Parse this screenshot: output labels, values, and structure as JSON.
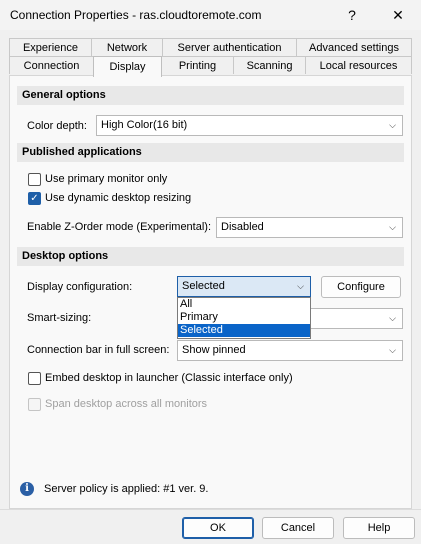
{
  "window": {
    "title": "Connection Properties - ras.cloudtoremote.com",
    "help_glyph": "?",
    "close_glyph": "✕"
  },
  "tabs": {
    "row1": [
      "Experience",
      "Network",
      "Server authentication",
      "Advanced settings"
    ],
    "row2": [
      "Connection",
      "Display",
      "Printing",
      "Scanning",
      "Local resources"
    ],
    "active": "Display"
  },
  "general": {
    "header": "General options",
    "color_depth_label": "Color depth:",
    "color_depth_value": "High Color(16 bit)"
  },
  "published": {
    "header": "Published applications",
    "primary_monitor_label": "Use primary monitor only",
    "primary_monitor_checked": false,
    "dynamic_resize_label": "Use dynamic desktop resizing",
    "dynamic_resize_checked": true,
    "zorder_label": "Enable Z-Order mode (Experimental):",
    "zorder_value": "Disabled"
  },
  "desktop": {
    "header": "Desktop options",
    "display_config_label": "Display configuration:",
    "display_config_value": "Selected",
    "display_config_options": [
      "All",
      "Primary",
      "Selected"
    ],
    "configure_button": "Configure",
    "smart_sizing_label": "Smart-sizing:",
    "smart_sizing_value": "",
    "connection_bar_label": "Connection bar in full screen:",
    "connection_bar_value": "Show pinned",
    "embed_label": "Embed desktop in launcher (Classic interface only)",
    "embed_checked": false,
    "span_label": "Span desktop across all monitors",
    "span_checked": false
  },
  "policy": {
    "text": "Server policy is applied: #1 ver. 9."
  },
  "buttons": {
    "ok": "OK",
    "cancel": "Cancel",
    "help": "Help"
  },
  "colors": {
    "accent": "#1e5fa8",
    "selection": "#0a64c8",
    "section_header_bg": "#e8e8e8"
  }
}
